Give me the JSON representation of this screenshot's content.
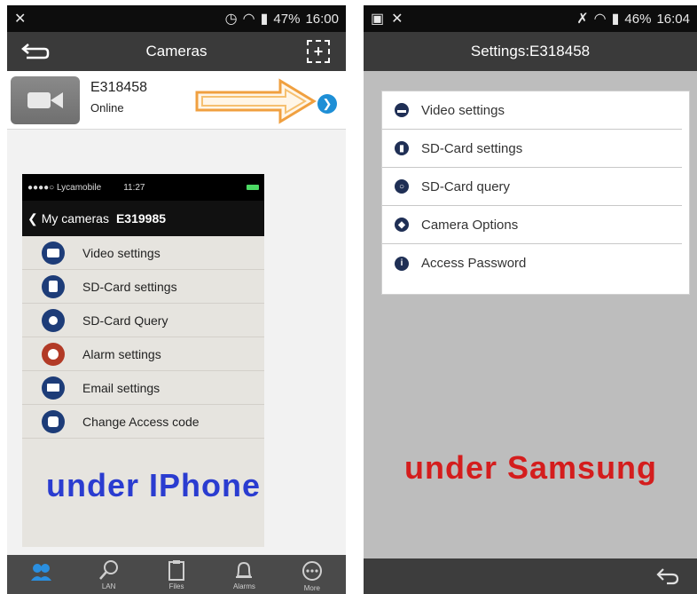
{
  "left_phone": {
    "status": {
      "battery": "47%",
      "time": "16:00"
    },
    "title": "Cameras",
    "camera": {
      "name": "E318458",
      "status": "Online"
    },
    "iphone": {
      "carrier": "●●●●○ Lycamobile",
      "time": "11:27",
      "back_label": "My cameras",
      "camera_id": "E319985",
      "items": [
        {
          "label": "Video settings",
          "icon": "video-icon",
          "color": "#1d3c78"
        },
        {
          "label": "SD-Card settings",
          "icon": "sdcard-icon",
          "color": "#1d3c78"
        },
        {
          "label": "SD-Card Query",
          "icon": "search-icon",
          "color": "#1d3c78"
        },
        {
          "label": "Alarm settings",
          "icon": "alarm-icon",
          "color": "#b23a26"
        },
        {
          "label": "Email settings",
          "icon": "email-icon",
          "color": "#1d3c78"
        },
        {
          "label": "Change Access code",
          "icon": "camera-options-icon",
          "color": "#1d3c78"
        }
      ]
    },
    "caption": "under IPhone",
    "tabs": [
      {
        "label": "",
        "icon": "devices-icon",
        "active": true
      },
      {
        "label": "LAN",
        "icon": "search-icon"
      },
      {
        "label": "Files",
        "icon": "files-icon"
      },
      {
        "label": "Alarms",
        "icon": "bell-icon"
      },
      {
        "label": "More",
        "icon": "more-icon"
      }
    ]
  },
  "right_phone": {
    "status": {
      "battery": "46%",
      "time": "16:04"
    },
    "title": "Settings:E318458",
    "items": [
      {
        "label": "Video settings",
        "icon": "video-icon"
      },
      {
        "label": "SD-Card settings",
        "icon": "sdcard-icon"
      },
      {
        "label": "SD-Card query",
        "icon": "search-icon"
      },
      {
        "label": "Camera Options",
        "icon": "camera-options-icon"
      },
      {
        "label": "Access Password",
        "icon": "info-icon"
      }
    ],
    "caption": "under Samsung"
  },
  "colors": {
    "accent_blue": "#1e8fd6",
    "arrow_orange": "#f0a040",
    "caption_blue": "#2a3cd0",
    "caption_red": "#d41d1d"
  }
}
